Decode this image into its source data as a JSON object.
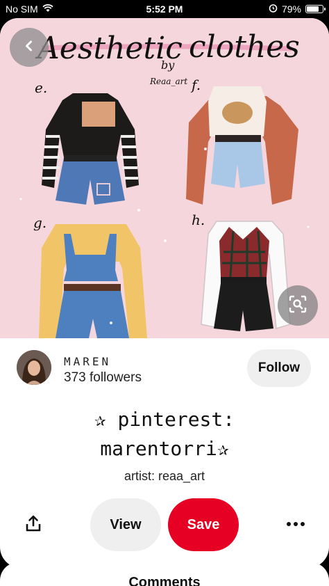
{
  "status_bar": {
    "carrier": "No SIM",
    "time": "5:52 PM",
    "battery": "79%",
    "battery_level": 0.79
  },
  "pin": {
    "image_texts": {
      "title_word_1": "Aesthetic",
      "title_word_2": "clothes",
      "byline_1": "by",
      "byline_2": "Reaa_art",
      "label_e": "e.",
      "label_f": "f.",
      "label_g": "g.",
      "label_h": "h."
    },
    "creator": {
      "name": "MAREN",
      "followers": "373 followers",
      "follow_label": "Follow"
    },
    "title_line_1": "✰ pinterest:",
    "title_line_2": "marentorri✰",
    "description": "artist: reaa_art"
  },
  "actions": {
    "view_label": "View",
    "save_label": "Save"
  },
  "comments": {
    "title": "Comments"
  },
  "colors": {
    "save": "#e60023",
    "image_bg": "#f5d6dd",
    "pill_bg": "#efefef"
  },
  "icons": [
    "wifi-icon",
    "alarm-icon",
    "back-chevron-icon",
    "visual-search-icon",
    "share-icon",
    "more-icon"
  ]
}
